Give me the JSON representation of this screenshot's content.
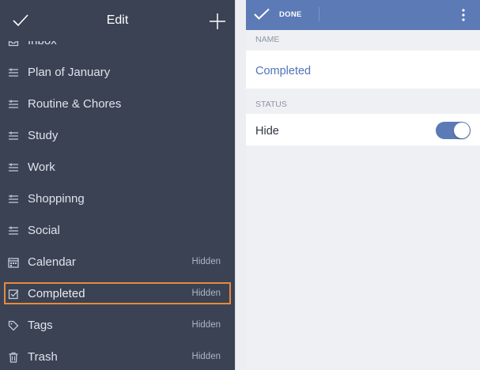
{
  "left_panel": {
    "title": "Edit",
    "items": [
      {
        "label": "Inbox",
        "status": "",
        "icon": "inbox-icon"
      },
      {
        "label": "Plan of January",
        "status": "",
        "icon": "list-icon"
      },
      {
        "label": "Routine & Chores",
        "status": "",
        "icon": "list-icon"
      },
      {
        "label": "Study",
        "status": "",
        "icon": "list-icon"
      },
      {
        "label": "Work",
        "status": "",
        "icon": "list-icon"
      },
      {
        "label": "Shoppinng",
        "status": "",
        "icon": "list-icon"
      },
      {
        "label": "Social",
        "status": "",
        "icon": "list-icon"
      },
      {
        "label": "Calendar",
        "status": "Hidden",
        "icon": "calendar-icon"
      },
      {
        "label": "Completed",
        "status": "Hidden",
        "icon": "completed-icon"
      },
      {
        "label": "Tags",
        "status": "Hidden",
        "icon": "tag-icon"
      },
      {
        "label": "Trash",
        "status": "Hidden",
        "icon": "trash-icon"
      }
    ],
    "selected_item": "Completed",
    "highlight_color": "#e88a3c"
  },
  "right_panel": {
    "done_label": "DONE",
    "name_section_label": "NAME",
    "name_value": "Completed",
    "status_section_label": "STATUS",
    "hide_label": "Hide",
    "hide_enabled": true,
    "accent_color": "#5b7ab6"
  }
}
